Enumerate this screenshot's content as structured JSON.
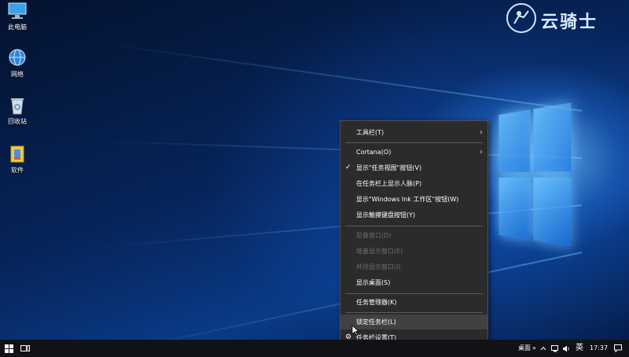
{
  "watermark": {
    "text": "云骑士"
  },
  "desktop_icons": [
    {
      "label": "此电脑",
      "icon": "computer-icon"
    },
    {
      "label": "网络",
      "icon": "network-icon"
    },
    {
      "label": "回收站",
      "icon": "recycle-bin-icon"
    },
    {
      "label": "软件",
      "icon": "folder-icon"
    }
  ],
  "context_menu": {
    "items": [
      {
        "label": "工具栏(T)",
        "submenu": true,
        "enabled": true
      },
      {
        "label": "Cortana(O)",
        "submenu": true,
        "enabled": true
      },
      {
        "label": "显示\"任务视图\"按钮(V)",
        "checked": true,
        "enabled": true
      },
      {
        "label": "在任务栏上显示人脉(P)",
        "enabled": true
      },
      {
        "label": "显示\"Windows Ink 工作区\"按钮(W)",
        "enabled": true
      },
      {
        "label": "显示触摸键盘按钮(Y)",
        "enabled": true
      },
      {
        "label": "层叠窗口(D)",
        "enabled": false
      },
      {
        "label": "堆叠显示窗口(E)",
        "enabled": false
      },
      {
        "label": "并排显示窗口(I)",
        "enabled": false
      },
      {
        "label": "显示桌面(S)",
        "enabled": true
      },
      {
        "label": "任务管理器(K)",
        "enabled": true
      },
      {
        "label": "锁定任务栏(L)",
        "enabled": true,
        "hovered": true
      },
      {
        "label": "任务栏设置(T)",
        "enabled": true,
        "icon": "gear-icon"
      }
    ]
  },
  "taskbar": {
    "desktop_label": "桌面",
    "overflow_label": "»",
    "ime_label": "英",
    "time": "17:37"
  },
  "colors": {
    "menu_bg": "#2b2b2b",
    "menu_hover": "#414141",
    "taskbar_bg": "#101216"
  }
}
